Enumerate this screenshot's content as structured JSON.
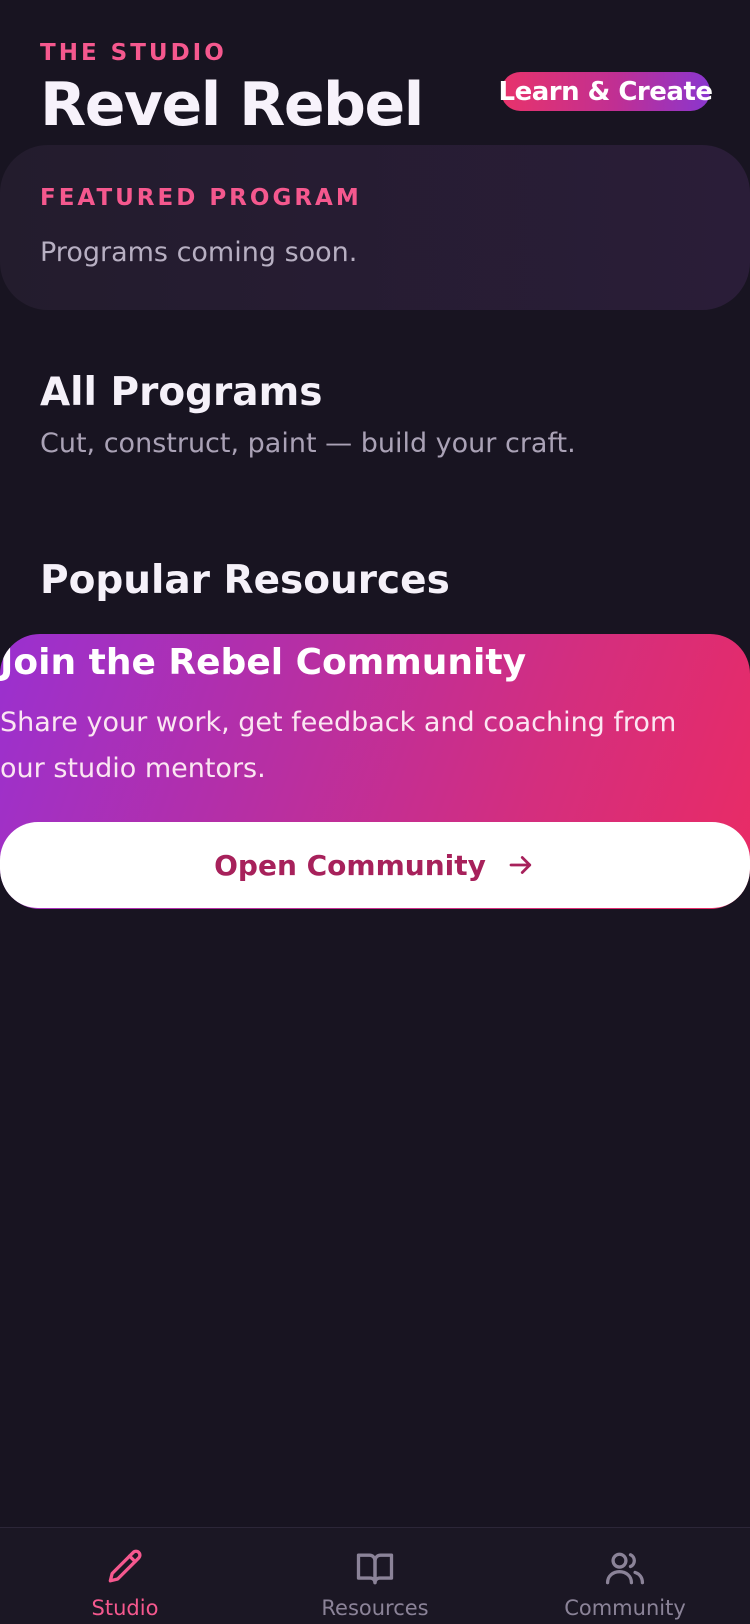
{
  "header": {
    "eyebrow": "THE STUDIO",
    "title": "Revel Rebel",
    "pill_label": "Learn & Create"
  },
  "featured": {
    "label": "FEATURED PROGRAM",
    "text": "Programs coming soon."
  },
  "programs": {
    "title": "All Programs",
    "subtitle": "Cut, construct, paint — build your craft."
  },
  "resources": {
    "title": "Popular Resources"
  },
  "community": {
    "title": "Join the Rebel Community",
    "description": "Share your work, get feedback and coaching from our studio mentors.",
    "button_label": "Open Community",
    "button_icon": "arrow-right-icon"
  },
  "tabs": [
    {
      "label": "Studio",
      "icon": "pencil-icon",
      "active": true
    },
    {
      "label": "Resources",
      "icon": "book-icon",
      "active": false
    },
    {
      "label": "Community",
      "icon": "users-icon",
      "active": false
    }
  ],
  "colors": {
    "background": "#181421",
    "accent_pink": "#f5588e",
    "gradient_pink": "#ea2b64",
    "gradient_purple": "#9a30d0",
    "button_text": "#a7215b"
  }
}
